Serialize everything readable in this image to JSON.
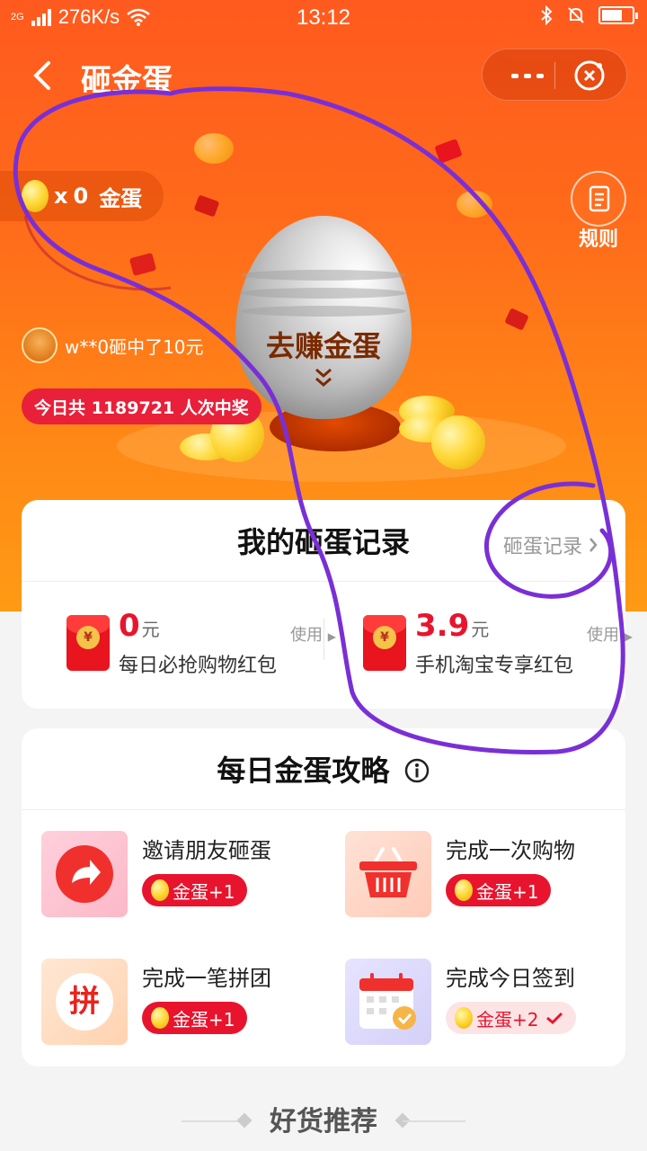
{
  "status_bar": {
    "network": "2G",
    "speed": "276K/s",
    "time": "13:12"
  },
  "nav": {
    "title": "砸金蛋"
  },
  "hero": {
    "egg_count": "0",
    "egg_count_prefix": "x",
    "egg_label": "金蛋",
    "rules_label": "规则",
    "egg_cta": "去赚金蛋",
    "winner_text": "w**0砸中了10元",
    "today_text": "今日共 1189721 人次中奖"
  },
  "records": {
    "title": "我的砸蛋记录",
    "link_label": "砸蛋记录",
    "packets": [
      {
        "amount": "0",
        "unit": "元",
        "use_label": "使用",
        "name": "每日必抢购物红包"
      },
      {
        "amount": "3.9",
        "unit": "元",
        "use_label": "使用",
        "name": "手机淘宝专享红包"
      }
    ]
  },
  "strategy": {
    "title": "每日金蛋攻略",
    "tasks": [
      {
        "name": "邀请朋友砸蛋",
        "reward": "金蛋+1",
        "icon": "share-arrow-icon"
      },
      {
        "name": "完成一次购物",
        "reward": "金蛋+1",
        "icon": "shopping-basket-icon"
      },
      {
        "name": "完成一笔拼团",
        "reward": "金蛋+1",
        "icon": "pin-group-icon",
        "icon_text": "拼"
      },
      {
        "name": "完成今日签到",
        "reward": "金蛋+2",
        "icon": "calendar-check-icon",
        "done": true
      }
    ]
  },
  "footer": {
    "section_title": "好货推荐"
  },
  "colors": {
    "primary_orange": "#ff6a1a",
    "accent_red": "#e8142e",
    "annotation_purple": "#7a2fd6"
  }
}
